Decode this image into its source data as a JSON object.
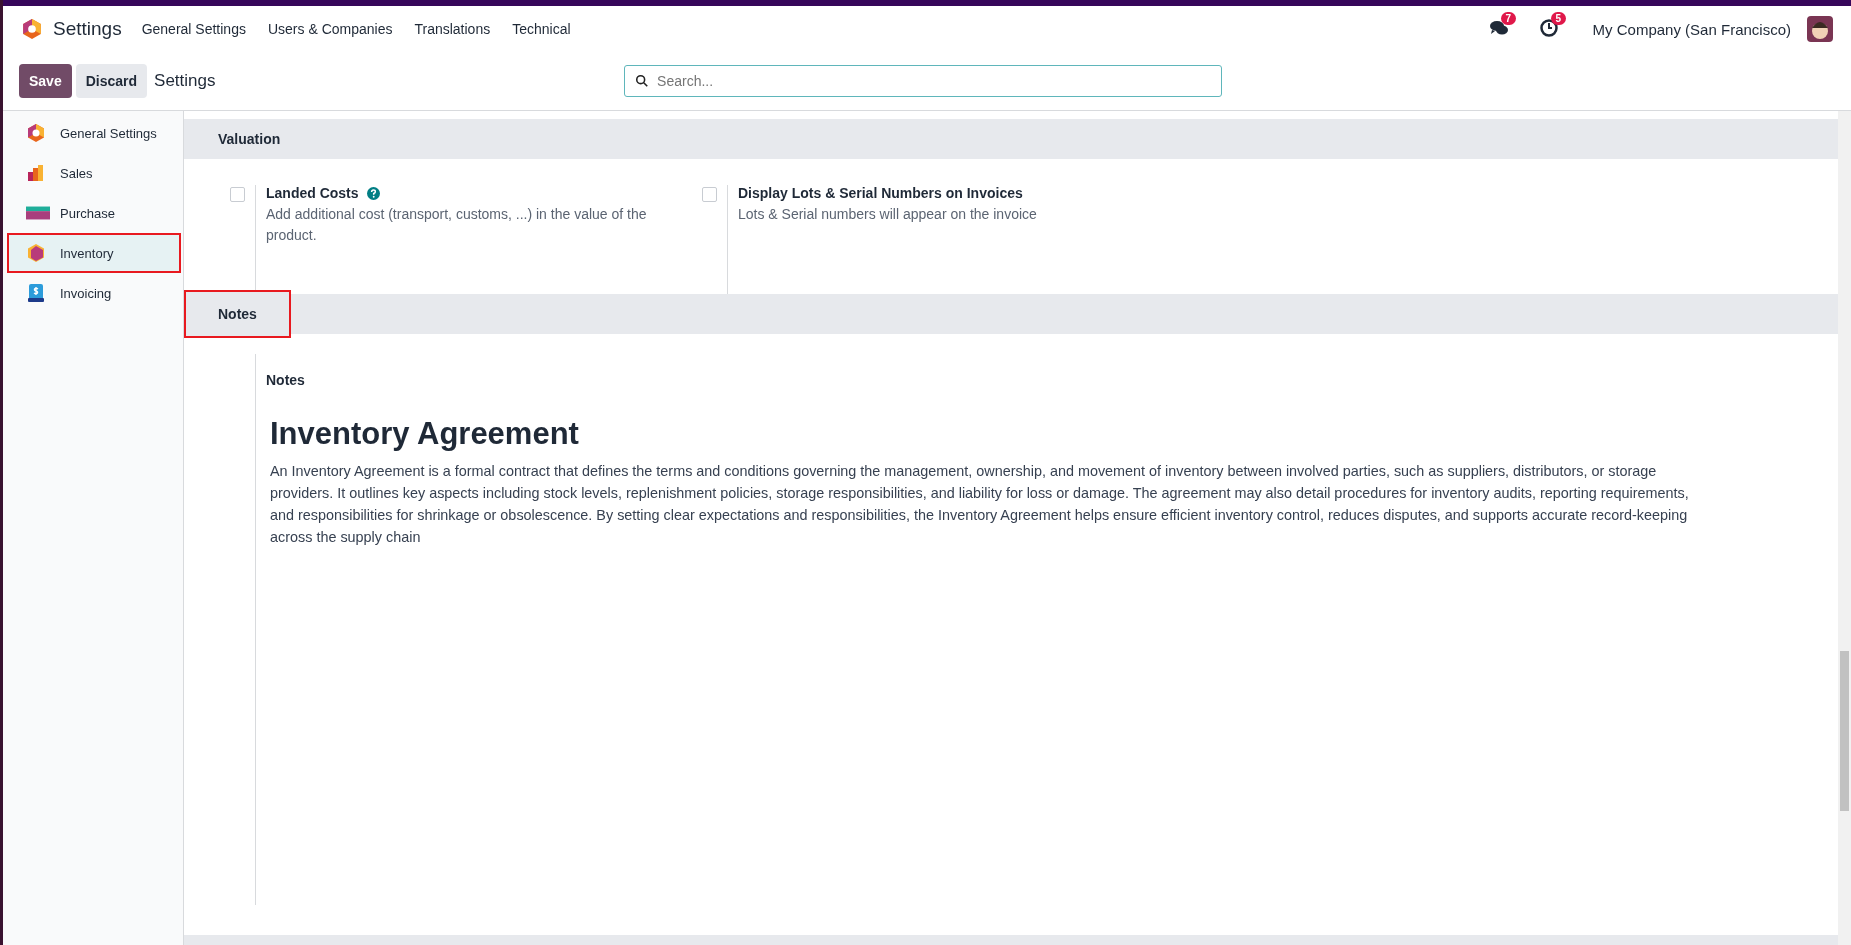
{
  "navbar": {
    "app_title": "Settings",
    "menu": [
      "General Settings",
      "Users & Companies",
      "Translations",
      "Technical"
    ],
    "messages_badge": "7",
    "activities_badge": "5",
    "company": "My Company (San Francisco)"
  },
  "control_panel": {
    "save": "Save",
    "discard": "Discard",
    "breadcrumb": "Settings",
    "search": {
      "placeholder": "Search..."
    }
  },
  "sidebar": {
    "items": [
      {
        "label": "General Settings",
        "selected": false,
        "highlighted": false
      },
      {
        "label": "Sales",
        "selected": false,
        "highlighted": false
      },
      {
        "label": "Purchase",
        "selected": false,
        "highlighted": false
      },
      {
        "label": "Inventory",
        "selected": true,
        "highlighted": true
      },
      {
        "label": "Invoicing",
        "selected": false,
        "highlighted": false
      }
    ]
  },
  "sections": [
    {
      "title": "Valuation",
      "highlighted": false,
      "kind": "settings",
      "settings": [
        {
          "label": "Landed Costs",
          "help": true,
          "checked": false,
          "description": "Add additional cost (transport, customs, ...) in the value of the product."
        },
        {
          "label": "Display Lots & Serial Numbers on Invoices",
          "help": false,
          "checked": false,
          "description": "Lots & Serial numbers will appear on the invoice"
        }
      ]
    },
    {
      "title": "Notes",
      "highlighted": true,
      "kind": "notes",
      "label": "Notes",
      "heading": "Inventory Agreement",
      "body": "An Inventory Agreement is a formal contract that defines the terms and conditions governing the management, ownership, and movement of inventory between involved parties, such as suppliers, distributors, or storage providers. It outlines key aspects including stock levels, replenishment policies, storage responsibilities, and liability for loss or damage. The agreement may also detail procedures for inventory audits, reporting requirements, and responsibilities for shrinkage or obsolescence. By setting clear expectations and responsibilities, the Inventory Agreement helps ensure efficient inventory control, reduces disputes, and supports accurate record-keeping across the supply chain"
    }
  ]
}
